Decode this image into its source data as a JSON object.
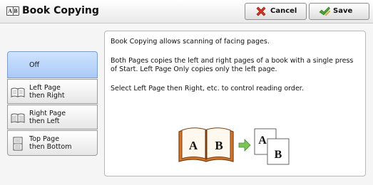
{
  "header": {
    "title": "Book Copying",
    "title_icon": {
      "left": "A",
      "right": "B"
    },
    "cancel_label": "Cancel",
    "save_label": "Save"
  },
  "options": {
    "selected": "Off",
    "items": [
      {
        "line1": "Off"
      },
      {
        "line1": "Left Page",
        "line2": "then Right"
      },
      {
        "line1": "Right Page",
        "line2": "then Left"
      },
      {
        "line1": "Top Page",
        "line2": "then Bottom"
      }
    ]
  },
  "description": {
    "p1": "Book Copying allows scanning of facing pages.",
    "p2": "Both Pages copies the left and right pages of a book with a single press of Start.  Left Page Only copies only the left page.",
    "p3": "Select Left Page then Right, etc. to control reading order."
  },
  "illustration": {
    "book_left": "A",
    "book_right": "B",
    "result_first": "A",
    "result_second": "B"
  },
  "colors": {
    "selected_option": "#b9d4fa",
    "book_cover": "#d4772c",
    "arrow": "#7cc35a",
    "cancel_icon": "#d6331f",
    "save_icon": "#4aa232"
  }
}
